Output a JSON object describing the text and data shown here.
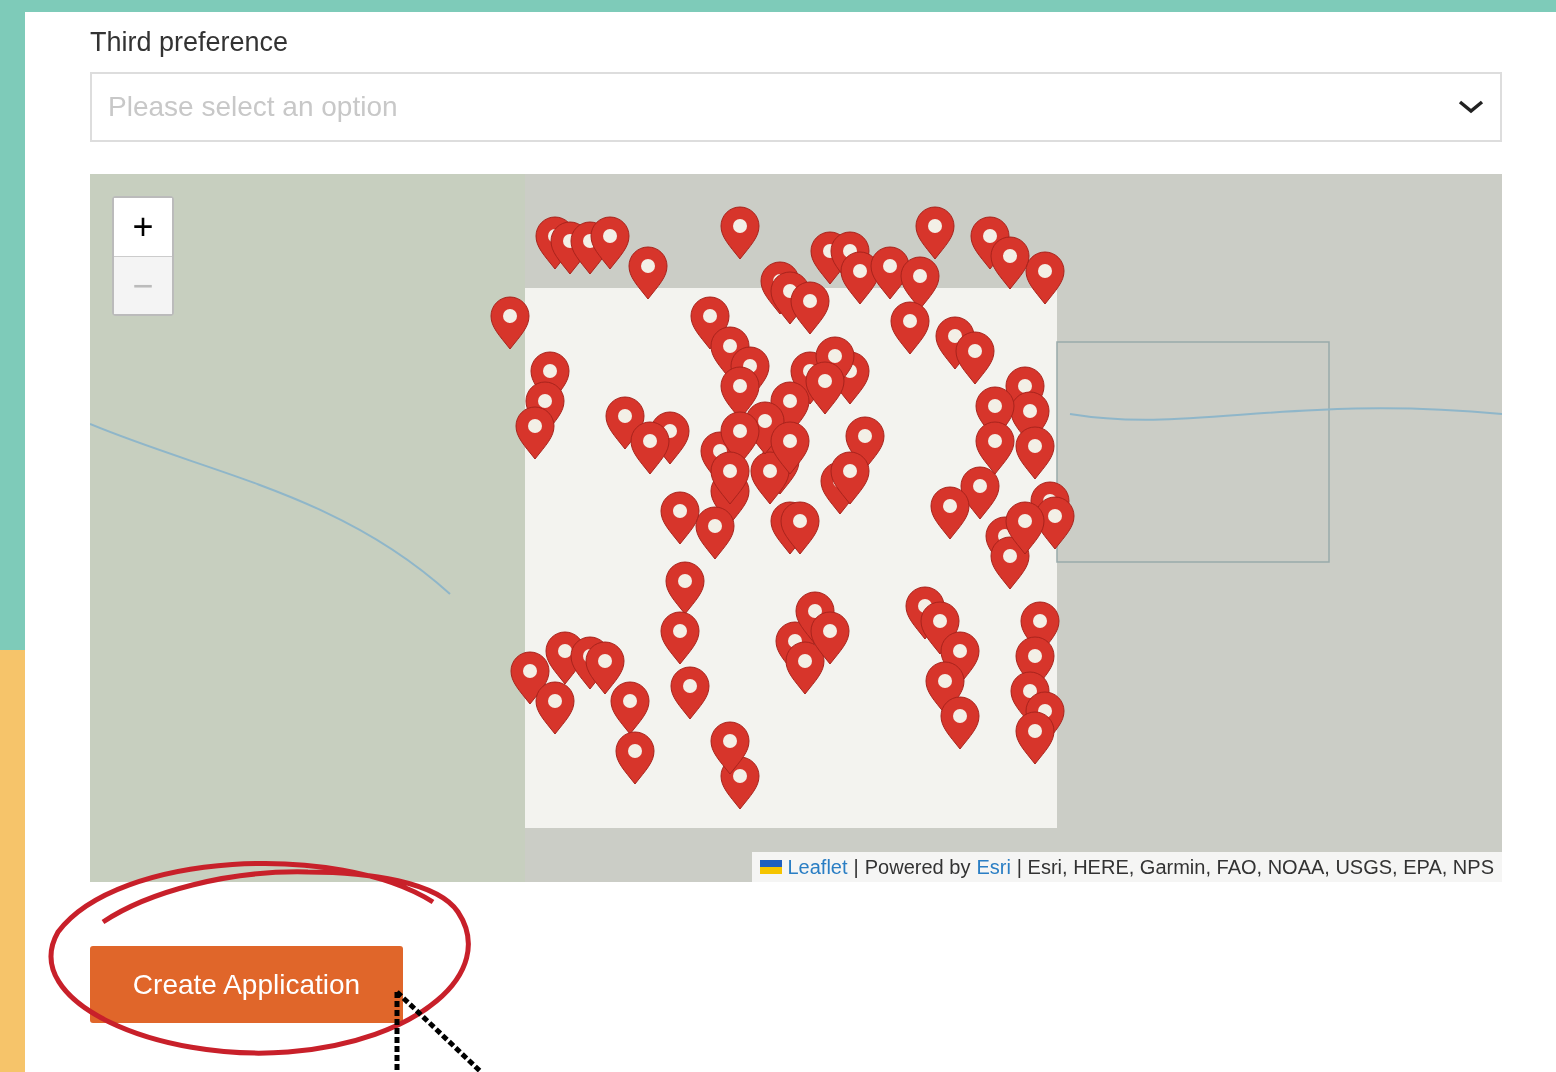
{
  "field": {
    "label": "Third preference",
    "placeholder": "Please select an option"
  },
  "map": {
    "zoom_controls": [
      {
        "label": "+",
        "disabled": false
      },
      {
        "label": "−",
        "disabled": true
      }
    ],
    "attribution": {
      "leaflet": "Leaflet",
      "separator": "|",
      "powered": "Powered by",
      "esri": "Esri",
      "sources": "| Esri, HERE, Garmin, FAO, NOAA, USGS, EPA, NPS"
    }
  },
  "button": {
    "label": "Create Application"
  }
}
